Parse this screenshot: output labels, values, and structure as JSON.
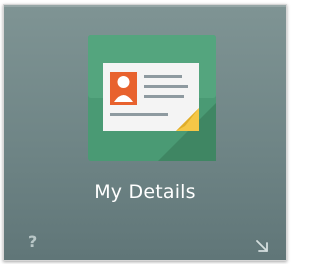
{
  "tile": {
    "title": "My Details",
    "icon": "contact-card-icon",
    "help_label": "?",
    "help_icon": "help-icon",
    "expand_icon": "expand-arrow-icon"
  },
  "colors": {
    "tile_background": "#738889",
    "icon_green": "#4a9a74",
    "avatar_orange": "#e8622e",
    "note_yellow": "#f5c747",
    "title_text": "#ffffff"
  }
}
